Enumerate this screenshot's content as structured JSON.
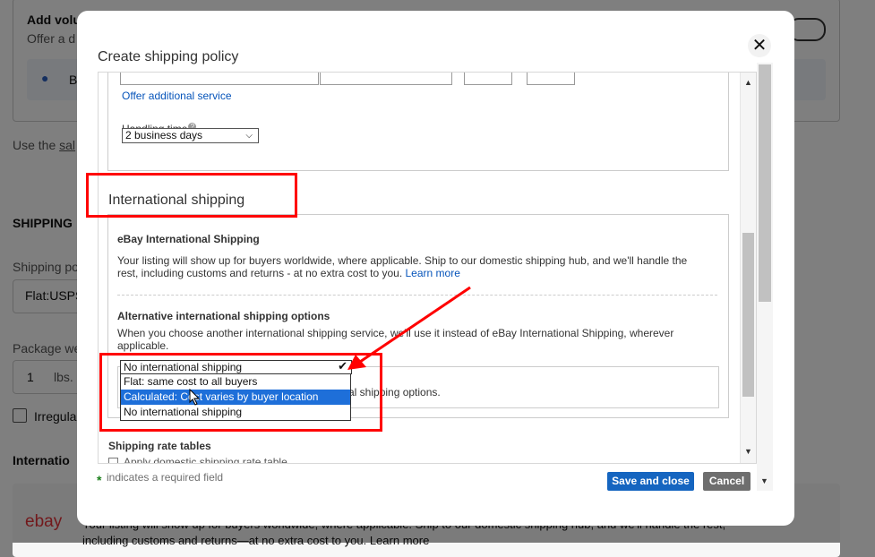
{
  "background": {
    "add_volume_title": "Add volu",
    "add_volume_desc": "Offer a d",
    "bullet_letter": "B",
    "use_the": "Use the",
    "use_the_link": "sal",
    "shipping_heading": "SHIPPING",
    "shipping_policy_label": "Shipping po",
    "shipping_policy_value": "Flat:USPS",
    "package_weight_label": "Package we",
    "weight_value": "1",
    "weight_unit": "lbs.",
    "irregular_label": "Irregula",
    "international_heading": "Internatio",
    "ebay_logo": "ebay",
    "bottom_line_1": "Your listing will show up for buyers worldwide, where applicable. Ship to our domestic shipping hub, and we'll handle the rest,",
    "bottom_line_2": "including customs and returns—at no extra cost to you. Learn more"
  },
  "modal": {
    "title": "Create shipping policy",
    "close_glyph": "✕",
    "offer_additional_service": "Offer additional service",
    "handling_time_label": "Handling time",
    "handling_time_value": "2 business days",
    "international_title": "International shipping",
    "ebay_intl_heading": "eBay International Shipping",
    "ebay_intl_desc_1": "Your listing will show up for buyers worldwide, where applicable. Ship to our domestic shipping hub, and we'll handle the",
    "ebay_intl_desc_2": "rest, including customs and returns - at no extra cost to you.",
    "learn_more": "Learn more",
    "alt_heading": "Alternative international shipping options",
    "alt_desc_1": "When you choose another international shipping service, we'll use it instead of eBay International Shipping, wherever",
    "alt_desc_2": "applicable.",
    "dropdown": {
      "selected": "No international shipping",
      "options": [
        "Flat: same cost to all buyers",
        "Calculated: Cost varies by buyer location",
        "No international shipping"
      ],
      "highlighted_index": 1
    },
    "behind_dropdown_text": "al shipping options.",
    "rate_tables_heading": "Shipping rate tables",
    "rate_tables_checkbox": "Apply domestic shipping rate table",
    "required_star": "*",
    "required_text": "indicates a required field",
    "save_button": "Save and close",
    "cancel_button": "Cancel"
  },
  "colors": {
    "highlight": "#ff0000",
    "link": "#0654ba",
    "save_button": "#1565c0",
    "cancel_button": "#6e6e6e",
    "selected_option": "#1e6fd9"
  }
}
